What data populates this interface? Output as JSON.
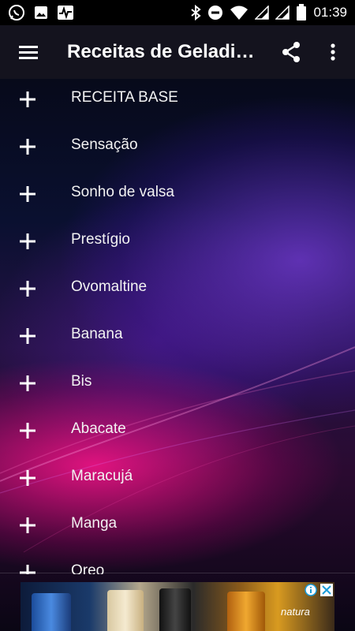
{
  "status_bar": {
    "time": "01:39",
    "left_icons": [
      "whatsapp-icon",
      "image-icon",
      "activity-icon"
    ],
    "right_icons": [
      "bluetooth-icon",
      "do-not-disturb-icon",
      "wifi-icon",
      "signal-icon",
      "signal-icon",
      "battery-icon"
    ]
  },
  "app_bar": {
    "title": "Receitas de Geladin…",
    "actions": [
      "share-icon",
      "more-vert-icon"
    ]
  },
  "list": {
    "items": [
      {
        "label": "RECEITA BASE"
      },
      {
        "label": "Sensação"
      },
      {
        "label": "Sonho de valsa"
      },
      {
        "label": "Prestígio"
      },
      {
        "label": "Ovomaltine"
      },
      {
        "label": "Banana"
      },
      {
        "label": "Bis"
      },
      {
        "label": "Abacate"
      },
      {
        "label": "Maracujá"
      },
      {
        "label": "Manga"
      },
      {
        "label": "Oreo"
      }
    ]
  },
  "ad": {
    "brand": "natura",
    "icons": [
      "ad-info-icon",
      "ad-close-icon"
    ]
  },
  "colors": {
    "status_bar_bg": "#000000",
    "app_bar_bg": "#14131e",
    "accent_pink": "#ff1a8c",
    "accent_purple": "#7a3cdc"
  }
}
